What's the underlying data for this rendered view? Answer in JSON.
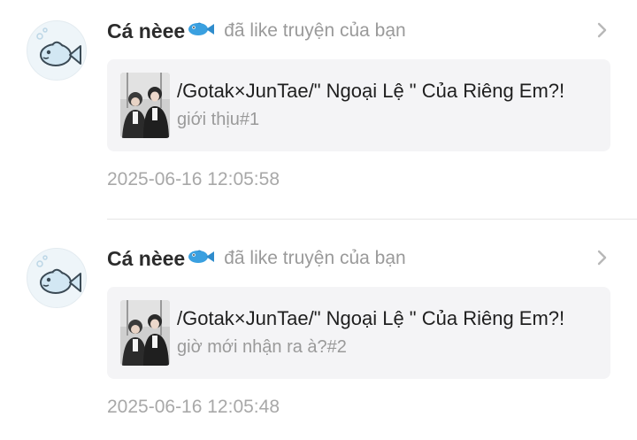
{
  "notifications": [
    {
      "user": "Cá nèee",
      "action": "đã like truyện của bạn",
      "story_title": "/Gotak×JunTae/\" Ngoại Lệ \" Của Riêng Em?!",
      "chapter": "giới thịu#1",
      "time": "2025-06-16 12:05:58"
    },
    {
      "user": "Cá nèee",
      "action": "đã like truyện của bạn",
      "story_title": "/Gotak×JunTae/\" Ngoại Lệ \" Của Riêng Em?!",
      "chapter": "giờ mới nhận ra à?#2",
      "time": "2025-06-16 12:05:48"
    }
  ],
  "icons": {
    "avatar": "fish-avatar-icon",
    "name_emoji": "blue-fish-icon",
    "chevron": "chevron-right-icon"
  },
  "colors": {
    "card_bg": "#f4f4f6",
    "username": "#2b2b2b",
    "secondary_text": "#9a9a9a",
    "fish_blue": "#3aa0e0"
  }
}
